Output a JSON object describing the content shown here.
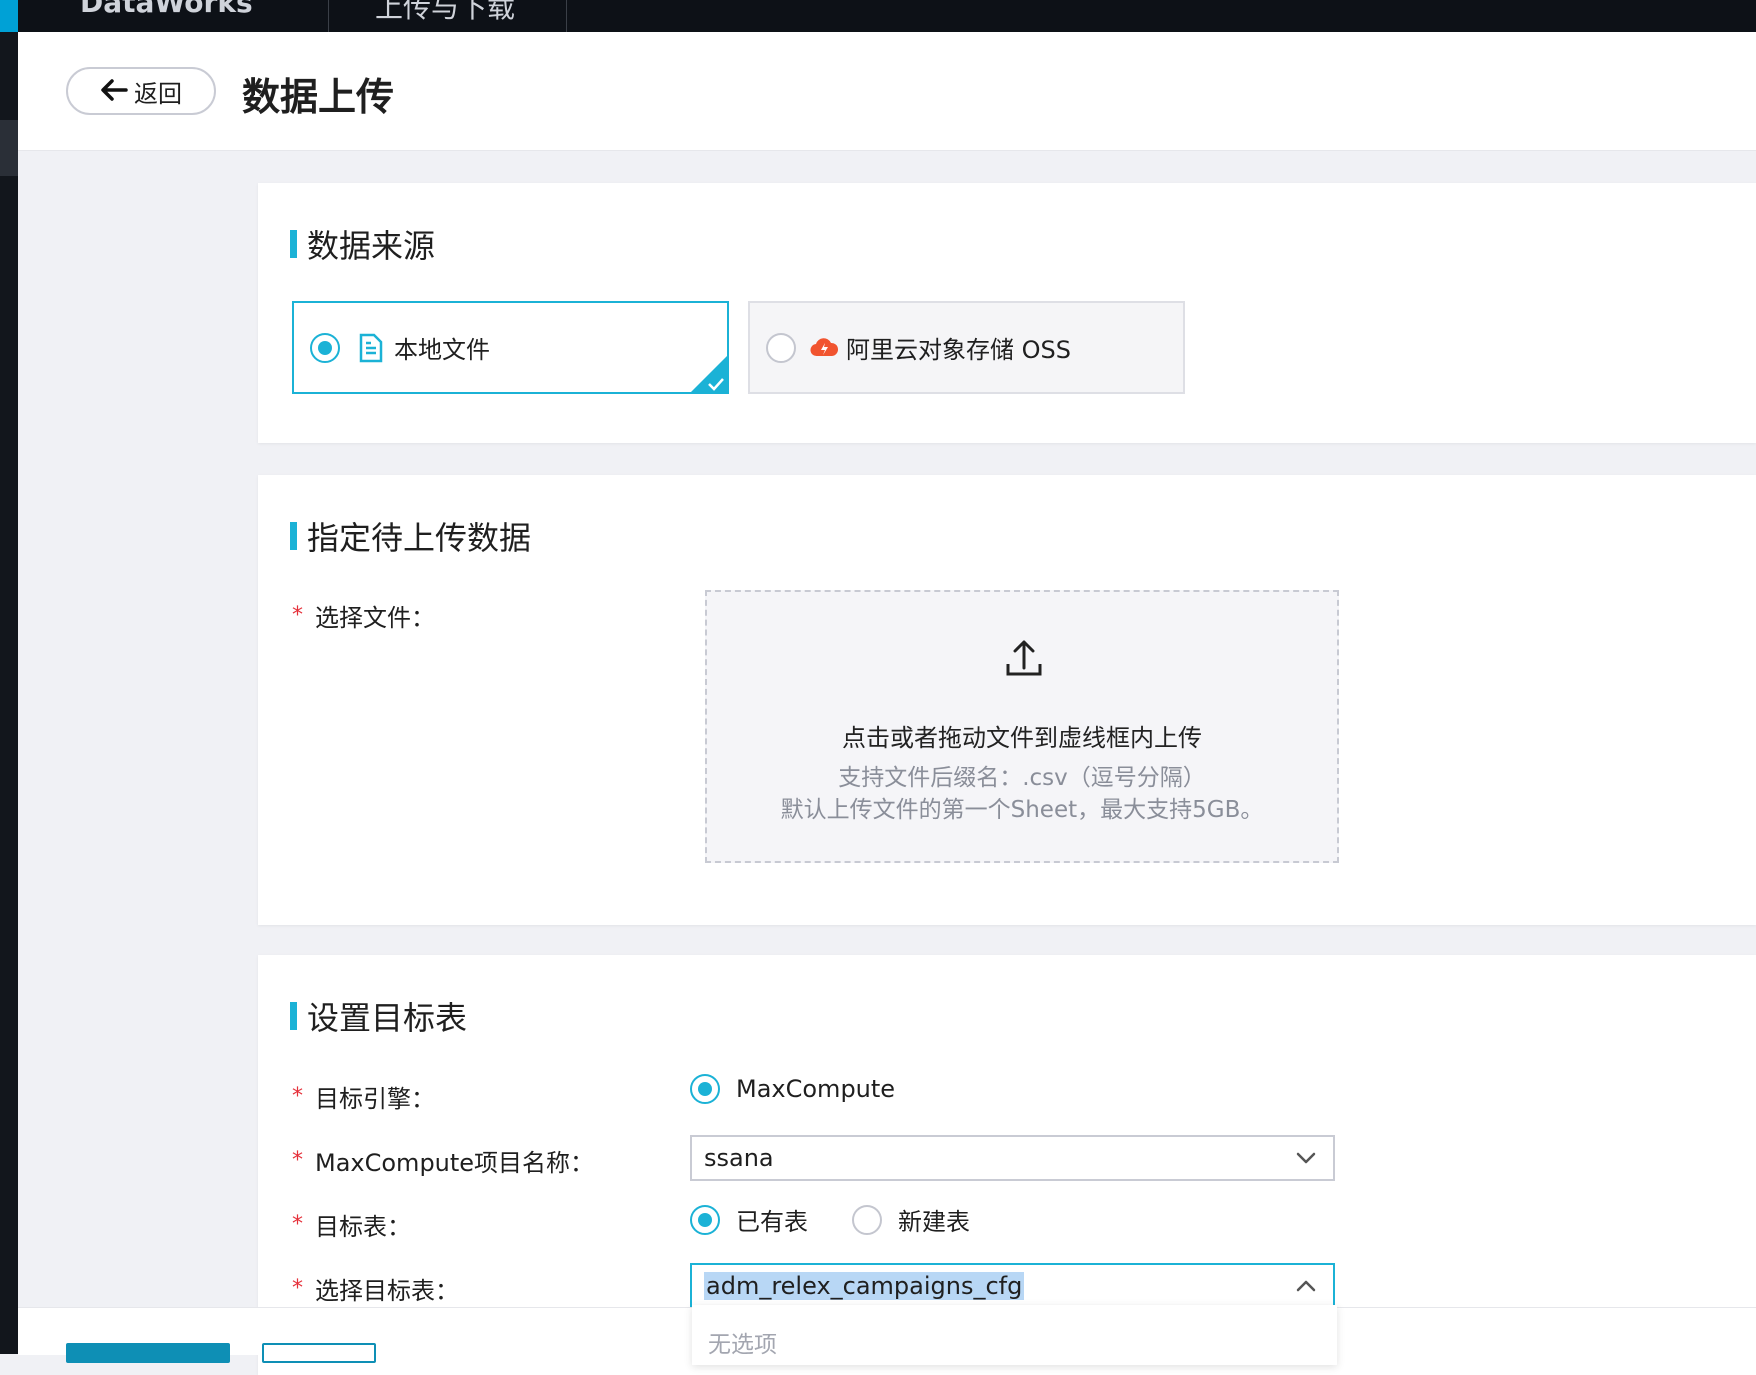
{
  "topbar": {
    "brand": "DataWorks",
    "tab": "上传与下载"
  },
  "header": {
    "back_label": "返回",
    "title": "数据上传"
  },
  "data_source": {
    "title": "数据来源",
    "options": [
      {
        "label": "本地文件",
        "selected": true
      },
      {
        "label": "阿里云对象存储 OSS",
        "selected": false
      }
    ]
  },
  "specify_data": {
    "title": "指定待上传数据",
    "file_label": "选择文件：",
    "dropzone_text": "点击或者拖动文件到虚线框内上传",
    "hint_line1": "支持文件后缀名：.csv（逗号分隔）",
    "hint_line2": "默认上传文件的第一个Sheet，最大支持5GB。"
  },
  "target": {
    "title": "设置目标表",
    "engine_label": "目标引擎：",
    "engine_value": "MaxCompute",
    "project_label": "MaxCompute项目名称：",
    "project_value": "ssana",
    "table_label": "目标表：",
    "table_options": [
      {
        "label": "已有表",
        "selected": true
      },
      {
        "label": "新建表",
        "selected": false
      }
    ],
    "select_table_label": "选择目标表：",
    "select_table_value": "adm_relex_campaigns_cfg",
    "dropdown_empty": "无选项"
  },
  "colors": {
    "accent": "#1bb2d6",
    "required": "#e5313b",
    "oss_icon": "#f1542f"
  }
}
